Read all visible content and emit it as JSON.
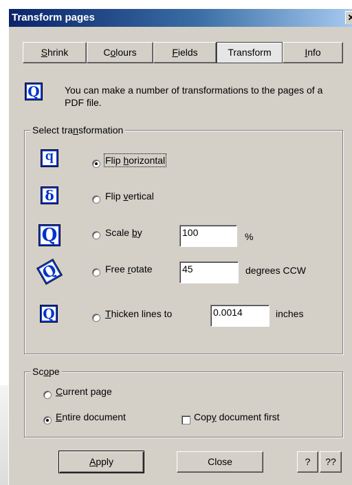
{
  "window": {
    "title": "Transform pages",
    "close_glyph": "✕"
  },
  "tabs": [
    {
      "label": "Shrink",
      "u": "S",
      "rest": "hrink",
      "active": false
    },
    {
      "label": "Colours",
      "u": "o",
      "pre": "C",
      "rest": "lours",
      "active": false
    },
    {
      "label": "Fields",
      "u": "F",
      "rest": "ields",
      "active": false
    },
    {
      "label": "Transform",
      "active": true
    },
    {
      "label": "Info",
      "u": "I",
      "rest": "nfo",
      "active": false
    }
  ],
  "intro": {
    "icon": "Q",
    "text": "You can make a number of transformations to the pages of a PDF file."
  },
  "transformation_group": {
    "legend_pre": "Select tra",
    "legend_u": "n",
    "legend_post": "sformation",
    "options": [
      {
        "icon": "Q-flip-horizontal",
        "glyph": "ᴘ",
        "pre": "Flip ",
        "u": "h",
        "post": "orizontal",
        "checked": true
      },
      {
        "icon": "Q-flip-vertical",
        "glyph": "ෙ",
        "pre": "Flip ",
        "u": "v",
        "post": "ertical",
        "checked": false
      },
      {
        "icon": "Q-scale",
        "glyph": "Q",
        "pre": "Scale ",
        "u": "b",
        "post": "y",
        "checked": false,
        "value": "100",
        "suffix": "%"
      },
      {
        "icon": "Q-rotate",
        "glyph": "Q",
        "pre": "Free ",
        "u": "r",
        "post": "otate",
        "checked": false,
        "value": "45",
        "suffix": "degrees CCW"
      },
      {
        "icon": "Q-thicken",
        "glyph": "Q",
        "pre": "",
        "u": "T",
        "post": "hicken lines to",
        "checked": false,
        "value": "0.0014",
        "suffix": "inches"
      }
    ]
  },
  "scope_group": {
    "legend_pre": "Sc",
    "legend_u": "o",
    "legend_post": "pe",
    "current_page": {
      "u": "C",
      "post": "urrent page",
      "checked": false
    },
    "entire_document": {
      "u": "E",
      "post": "ntire document",
      "checked": true
    },
    "copy_first": {
      "pre": "Cop",
      "u": "y",
      "post": " document first",
      "checked": false
    }
  },
  "buttons": {
    "apply_u": "A",
    "apply_post": "pply",
    "close": "Close",
    "help": "?",
    "help2": "??"
  }
}
